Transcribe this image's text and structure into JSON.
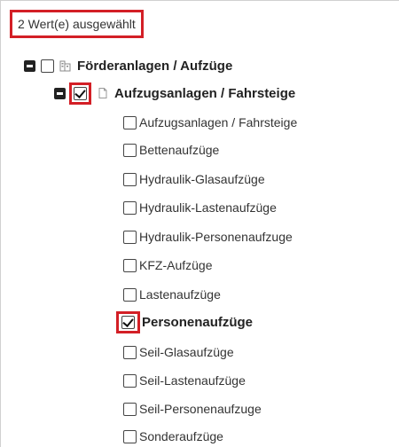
{
  "summary": {
    "text": "2 Wert(e) ausgewählt"
  },
  "tree": {
    "root": {
      "label": "Förderanlagen / Aufzüge",
      "checked": false,
      "icon": "building-icon"
    },
    "group": {
      "label": "Aufzugsanlagen / Fahrsteige",
      "checked": true,
      "icon": "document-icon"
    },
    "leaves": [
      {
        "label": "Aufzugsanlagen / Fahrsteige",
        "checked": false
      },
      {
        "label": "Bettenaufzüge",
        "checked": false
      },
      {
        "label": "Hydraulik-Glasaufzüge",
        "checked": false
      },
      {
        "label": "Hydraulik-Lastenaufzüge",
        "checked": false
      },
      {
        "label": "Hydraulik-Personenaufzuge",
        "checked": false
      },
      {
        "label": "KFZ-Aufzüge",
        "checked": false
      },
      {
        "label": "Lastenaufzüge",
        "checked": false
      },
      {
        "label": "Personenaufzüge",
        "checked": true
      },
      {
        "label": "Seil-Glasaufzüge",
        "checked": false
      },
      {
        "label": "Seil-Lastenaufzüge",
        "checked": false
      },
      {
        "label": "Seil-Personenaufzuge",
        "checked": false
      },
      {
        "label": "Sonderaufzüge",
        "checked": false
      }
    ]
  },
  "colors": {
    "highlight": "#d31f26",
    "text": "#222222"
  }
}
